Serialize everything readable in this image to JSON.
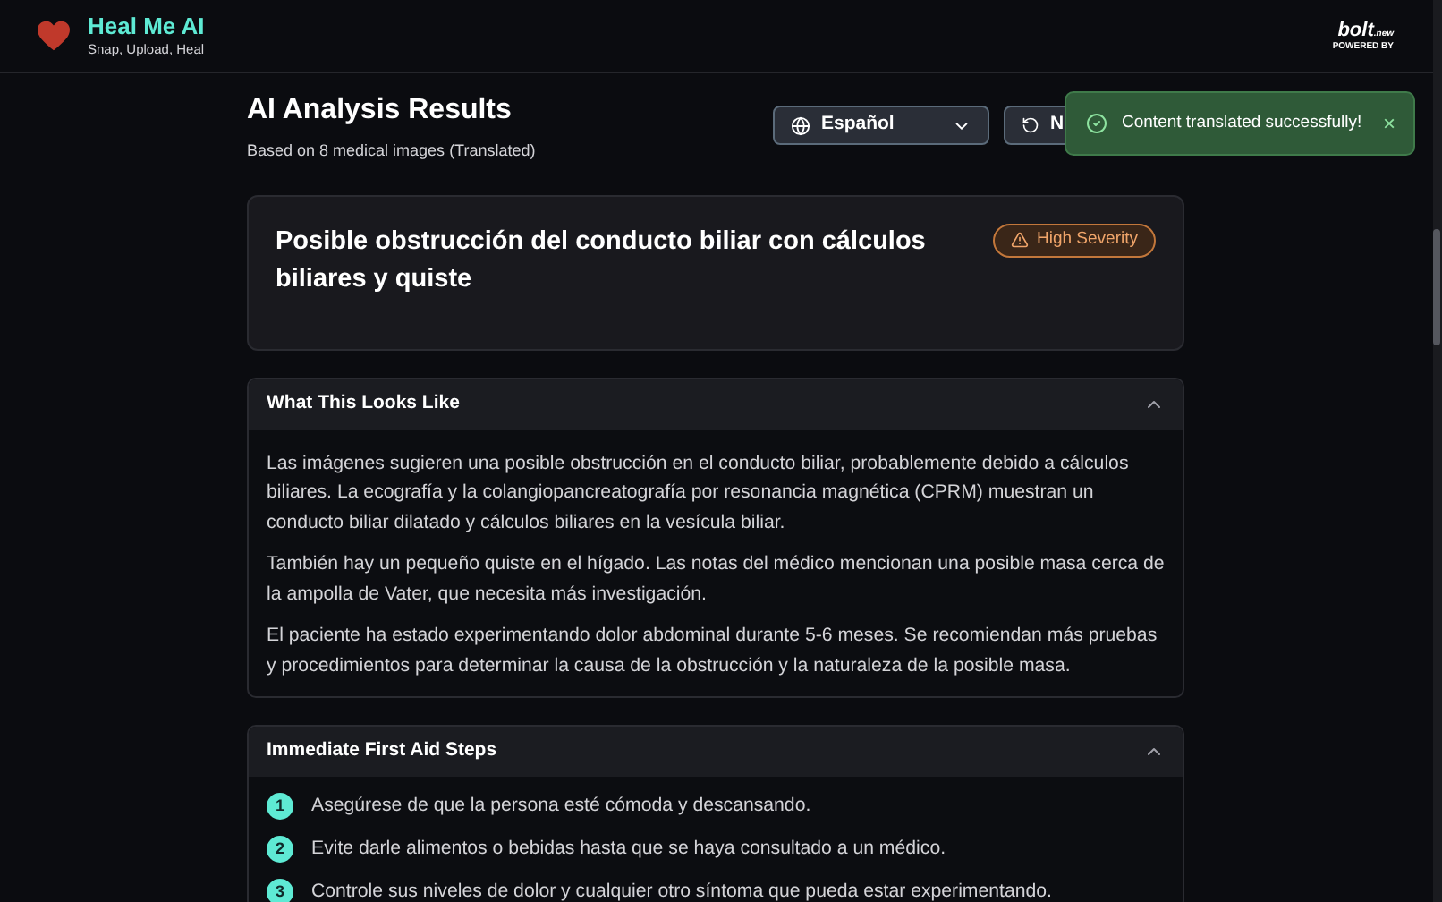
{
  "header": {
    "title": "Heal Me AI",
    "tagline": "Snap, Upload, Heal",
    "badge": {
      "brand": "bolt",
      "suffix": ".new",
      "caption": "POWERED BY"
    }
  },
  "results": {
    "title": "AI Analysis Results",
    "subtitle": "Based on 8 medical images (Translated)",
    "language": "Español",
    "new_button": "N"
  },
  "toast": {
    "message": "Content translated successfully!",
    "close": "×"
  },
  "diagnosis": {
    "title": "Posible obstrucción del conducto biliar con cálculos biliares y quiste",
    "severity": "High Severity"
  },
  "sections": [
    {
      "title": "What This Looks Like",
      "expanded": true,
      "kind": "paragraphs",
      "paragraphs": [
        "Las imágenes sugieren una posible obstrucción en el conducto biliar, probablemente debido a cálculos biliares. La ecografía y la colangiopancreatografía por resonancia magnética (CPRM) muestran un conducto biliar dilatado y cálculos biliares en la vesícula biliar.",
        "También hay un pequeño quiste en el hígado. Las notas del médico mencionan una posible masa cerca de la ampolla de Vater, que necesita más investigación.",
        "El paciente ha estado experimentando dolor abdominal durante 5-6 meses. Se recomiendan más pruebas y procedimientos para determinar la causa de la obstrucción y la naturaleza de la posible masa."
      ]
    },
    {
      "title": "Immediate First Aid Steps",
      "expanded": true,
      "kind": "steps",
      "steps": [
        {
          "number": "1",
          "text": "Asegúrese de que la persona esté cómoda y descansando."
        },
        {
          "number": "2",
          "text": "Evite darle alimentos o bebidas hasta que se haya consultado a un médico."
        },
        {
          "number": "3",
          "text": "Controle sus niveles de dolor y cualquier otro síntoma que pueda estar experimentando."
        }
      ]
    }
  ]
}
